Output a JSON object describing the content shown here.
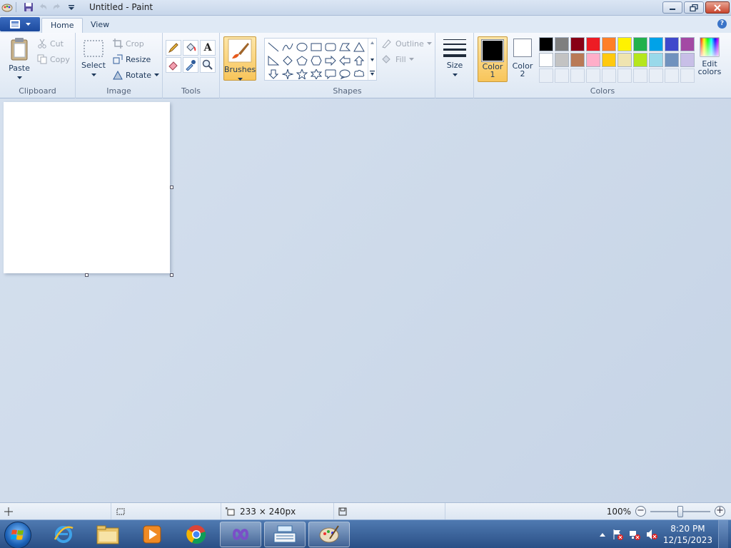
{
  "window": {
    "title": "Untitled - Paint"
  },
  "tabs": [
    {
      "label": "Home",
      "active": true
    },
    {
      "label": "View",
      "active": false
    }
  ],
  "clipboard": {
    "group_label": "Clipboard",
    "paste_label": "Paste",
    "cut_label": "Cut",
    "copy_label": "Copy"
  },
  "image": {
    "group_label": "Image",
    "select_label": "Select",
    "crop_label": "Crop",
    "resize_label": "Resize",
    "rotate_label": "Rotate"
  },
  "tools": {
    "group_label": "Tools",
    "brushes_label": "Brushes"
  },
  "shapes": {
    "group_label": "Shapes",
    "outline_label": "Outline",
    "fill_label": "Fill"
  },
  "size": {
    "label": "Size"
  },
  "colors": {
    "group_label": "Colors",
    "color1_label": "Color",
    "color1_num": "1",
    "color2_label": "Color",
    "color2_num": "2",
    "edit_label": "Edit",
    "edit_label2": "colors",
    "color1_value": "#000000",
    "color2_value": "#ffffff",
    "palette_row1": [
      "#000000",
      "#7f7f7f",
      "#880015",
      "#ed1c24",
      "#ff7f27",
      "#fff200",
      "#22b14c",
      "#00a2e8",
      "#3f48cc",
      "#a349a4"
    ],
    "palette_row2": [
      "#ffffff",
      "#c3c3c3",
      "#b97a57",
      "#ffaec9",
      "#ffc90e",
      "#efe4b0",
      "#b5e61d",
      "#99d9ea",
      "#7092be",
      "#c8bfe7"
    ],
    "palette_row3": [
      "#e8eef6",
      "#e8eef6",
      "#e8eef6",
      "#e8eef6",
      "#e8eef6",
      "#e8eef6",
      "#e8eef6",
      "#e8eef6",
      "#e8eef6",
      "#e8eef6"
    ]
  },
  "status": {
    "canvas_size": "233 × 240px",
    "zoom": "100%",
    "zoom_fraction": 0.5
  },
  "taskbar": {
    "time": "8:20 PM",
    "date": "12/15/2023"
  }
}
